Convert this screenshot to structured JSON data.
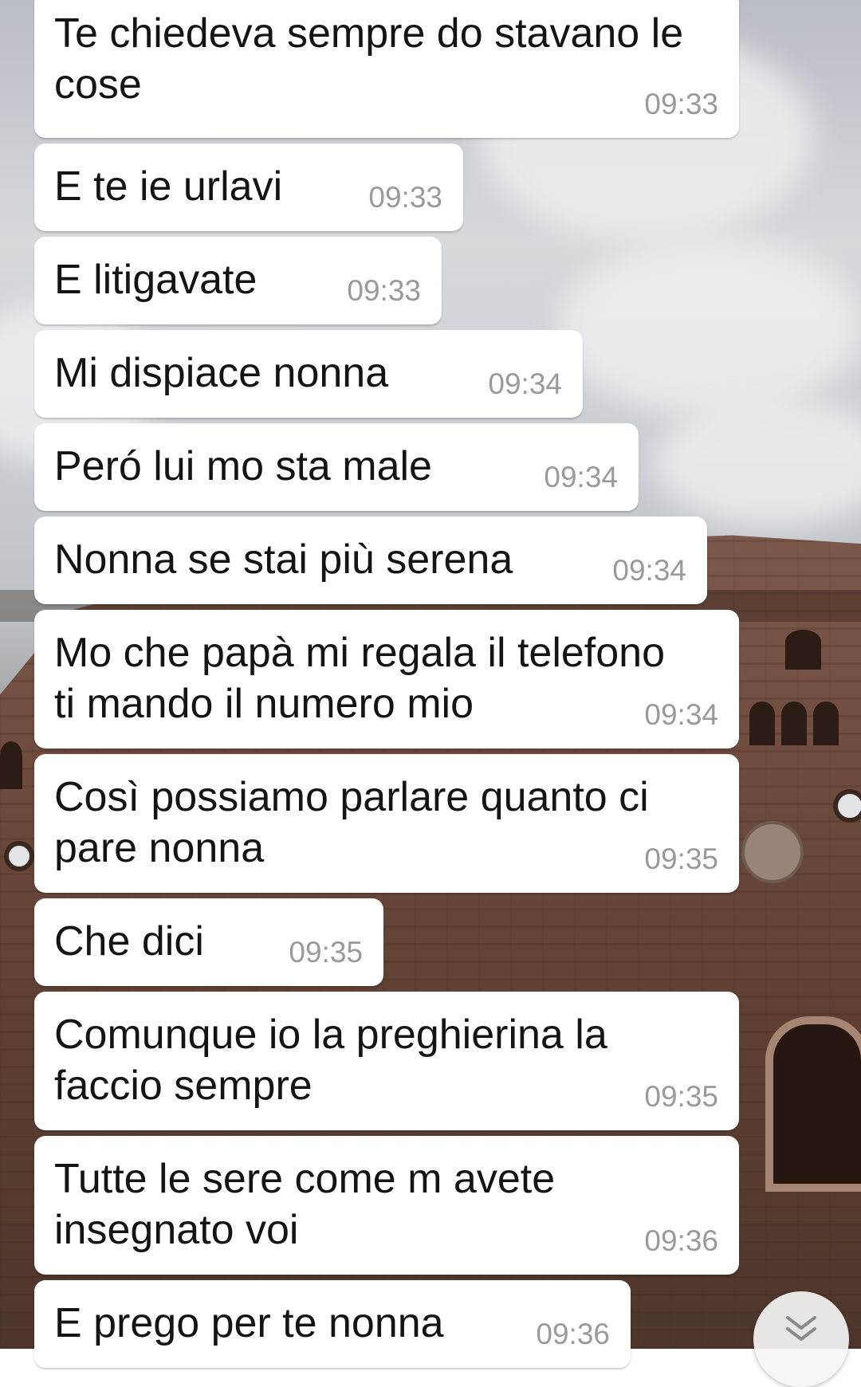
{
  "messages": [
    {
      "lines": [
        "Te chiedeva sempre do stavano le",
        "cose"
      ],
      "time": "09:33"
    },
    {
      "lines": [
        "E te ie urlavi"
      ],
      "time": "09:33"
    },
    {
      "lines": [
        "E litigavate"
      ],
      "time": "09:33"
    },
    {
      "lines": [
        "Mi dispiace nonna"
      ],
      "time": "09:34"
    },
    {
      "lines": [
        "Peró lui mo sta male"
      ],
      "time": "09:34"
    },
    {
      "lines": [
        "Nonna se stai più serena"
      ],
      "time": "09:34"
    },
    {
      "lines": [
        "Mo che papà mi regala il telefono",
        "ti mando il numero mio"
      ],
      "time": "09:34"
    },
    {
      "lines": [
        "Così possiamo parlare quanto ci",
        "pare nonna"
      ],
      "time": "09:35"
    },
    {
      "lines": [
        "Che dici"
      ],
      "time": "09:35"
    },
    {
      "lines": [
        "Comunque io la preghierina la",
        "faccio sempre"
      ],
      "time": "09:35"
    },
    {
      "lines": [
        "Tutte le sere come m avete",
        "insegnato voi"
      ],
      "time": "09:36"
    },
    {
      "lines": [
        "E prego per te nonna"
      ],
      "time": "09:36"
    }
  ],
  "scroll_button": {
    "icon": "double-chevron-down-icon"
  },
  "colors": {
    "bubble_bg": "#ffffff",
    "message_text": "#141414",
    "timestamp_text": "#9a9a9a"
  }
}
